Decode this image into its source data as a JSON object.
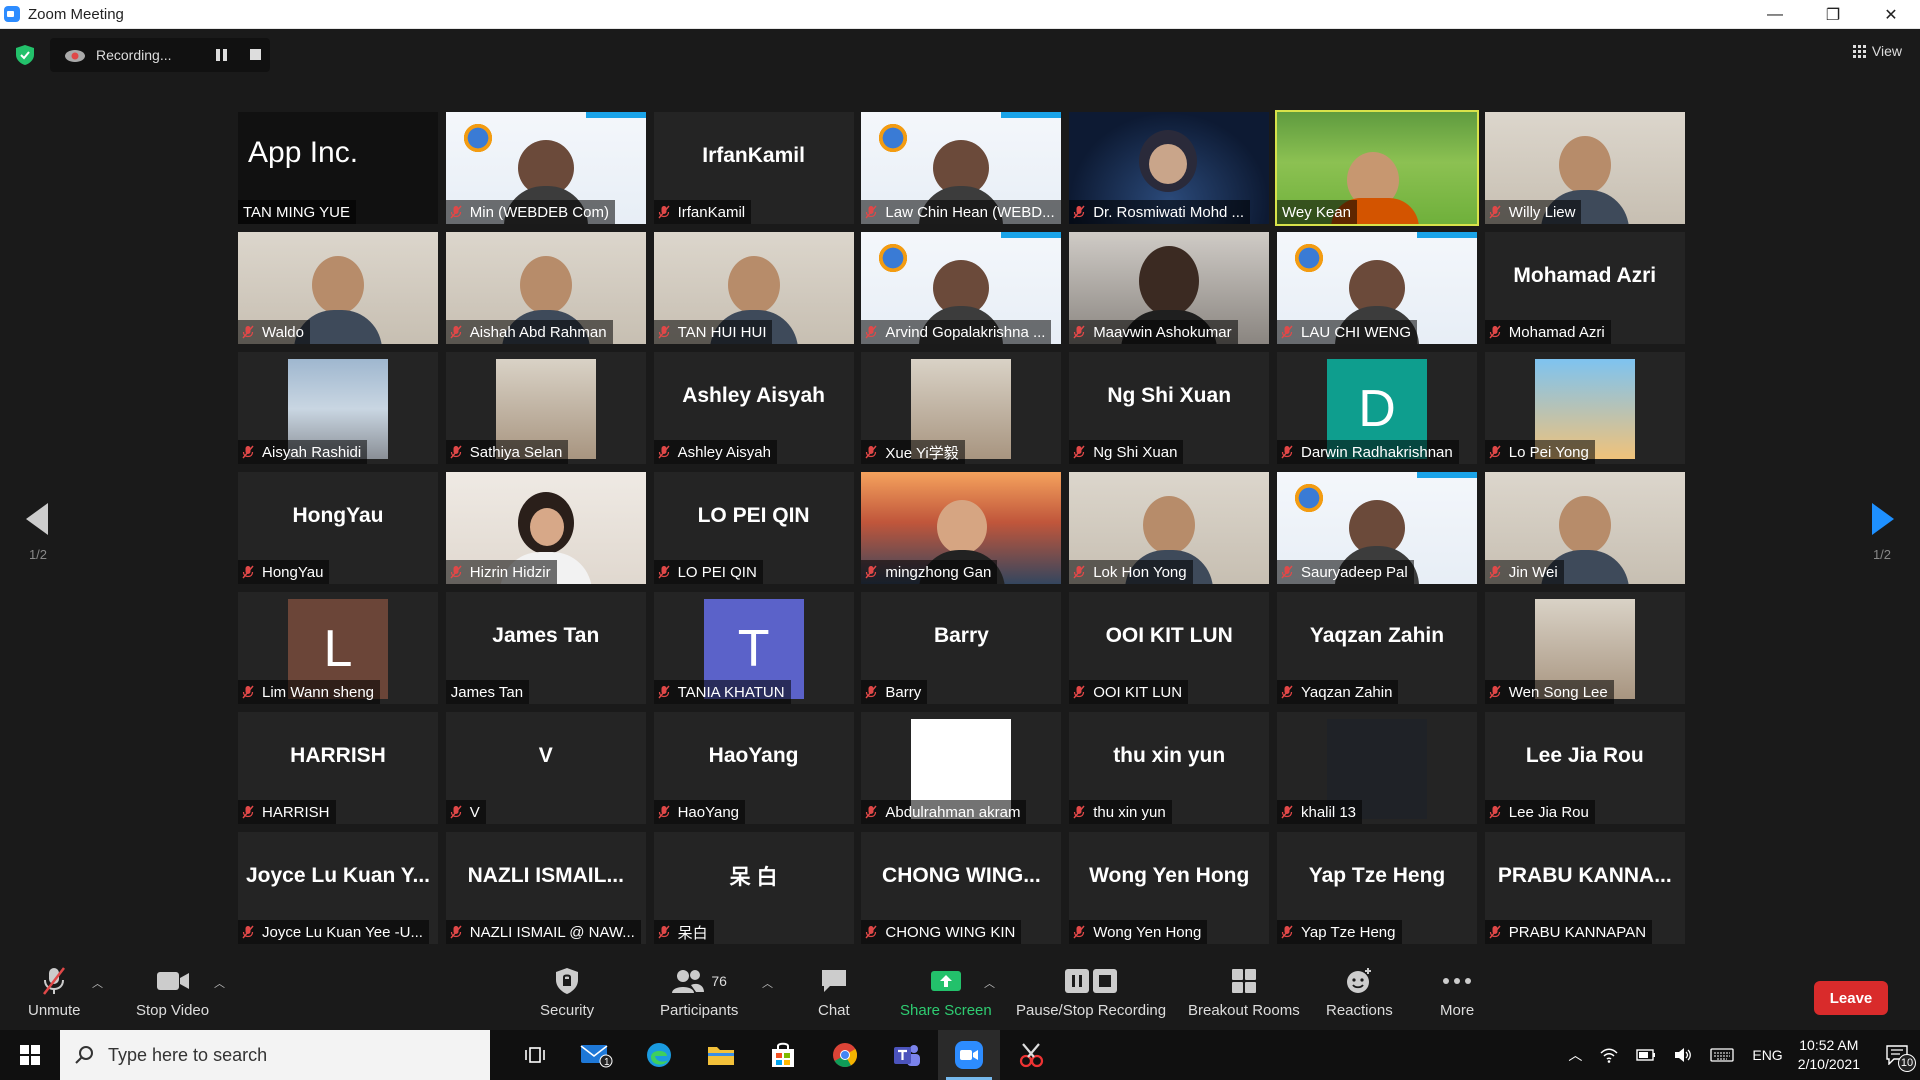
{
  "window": {
    "title": "Zoom Meeting",
    "minimize": "—",
    "restore": "❐",
    "close": "✕"
  },
  "topbar": {
    "recording_label": "Recording...",
    "view_label": "View"
  },
  "paging": {
    "prev_label": "1/2",
    "next_label": "1/2"
  },
  "participants": [
    {
      "name": "TAN MING YUE",
      "kind": "video",
      "muted": false,
      "video_theme": "apple",
      "apple_text": "App  Inc."
    },
    {
      "name": "Min (WEBDEB Com)",
      "kind": "video",
      "muted": true,
      "video_theme": "ieee"
    },
    {
      "name": "IrfanKamil",
      "kind": "text",
      "muted": true,
      "big": "IrfanKamil"
    },
    {
      "name": "Law Chin Hean (WEBD...",
      "kind": "video",
      "muted": true,
      "video_theme": "ieee"
    },
    {
      "name": "Dr. Rosmiwati Mohd ...",
      "kind": "video",
      "muted": true,
      "video_theme": "space"
    },
    {
      "name": "Wey Kean",
      "kind": "video",
      "muted": false,
      "video_theme": "forest",
      "active": true
    },
    {
      "name": "Willy Liew",
      "kind": "video",
      "muted": true,
      "video_theme": "room"
    },
    {
      "name": "Waldo",
      "kind": "video",
      "muted": true,
      "video_theme": "room"
    },
    {
      "name": "Aishah Abd Rahman",
      "kind": "video",
      "muted": true,
      "video_theme": "room"
    },
    {
      "name": "TAN HUI HUI",
      "kind": "video",
      "muted": true,
      "video_theme": "room"
    },
    {
      "name": "Arvind Gopalakrishna ...",
      "kind": "video",
      "muted": true,
      "video_theme": "ieee"
    },
    {
      "name": "Maavwin Ashokumar",
      "kind": "video",
      "muted": true,
      "video_theme": "dark"
    },
    {
      "name": "LAU CHI WENG",
      "kind": "video",
      "muted": true,
      "video_theme": "ieee"
    },
    {
      "name": "Mohamad Azri",
      "kind": "text",
      "muted": true,
      "big": "Mohamad Azri"
    },
    {
      "name": "Aisyah Rashidi",
      "kind": "avatarimg",
      "muted": true,
      "img_theme": "building"
    },
    {
      "name": "Sathiya Selan",
      "kind": "avatarimg",
      "muted": true,
      "img_theme": "person"
    },
    {
      "name": "Ashley Aisyah",
      "kind": "text",
      "muted": true,
      "big": "Ashley Aisyah"
    },
    {
      "name": "Xue Yi学毅",
      "kind": "avatarimg",
      "muted": true,
      "img_theme": "person"
    },
    {
      "name": "Ng Shi Xuan",
      "kind": "text",
      "muted": true,
      "big": "Ng Shi Xuan"
    },
    {
      "name": "Darwin Radhakrishnan",
      "kind": "avatar",
      "muted": true,
      "letter": "D",
      "color": "#0e9e8e"
    },
    {
      "name": "Lo Pei Yong",
      "kind": "avatarimg",
      "muted": true,
      "img_theme": "cartoon"
    },
    {
      "name": "HongYau",
      "kind": "text",
      "muted": true,
      "big": "HongYau"
    },
    {
      "name": "Hizrin Hidzir",
      "kind": "video",
      "muted": true,
      "video_theme": "light"
    },
    {
      "name": "LO PEI QIN",
      "kind": "text",
      "muted": true,
      "big": "LO PEI QIN"
    },
    {
      "name": "mingzhong Gan",
      "kind": "video",
      "muted": true,
      "video_theme": "sunset"
    },
    {
      "name": "Lok Hon Yong",
      "kind": "video",
      "muted": true,
      "video_theme": "room"
    },
    {
      "name": "Sauryadeep Pal",
      "kind": "video",
      "muted": true,
      "video_theme": "ieee"
    },
    {
      "name": "Jin Wei",
      "kind": "video",
      "muted": true,
      "video_theme": "room"
    },
    {
      "name": "Lim Wann sheng",
      "kind": "avatar",
      "muted": true,
      "letter": "L",
      "color": "#6b4538"
    },
    {
      "name": "James Tan",
      "kind": "text",
      "muted": false,
      "big": "James Tan"
    },
    {
      "name": "TANIA KHATUN",
      "kind": "avatar",
      "muted": true,
      "letter": "T",
      "color": "#5b62c9"
    },
    {
      "name": "Barry",
      "kind": "text",
      "muted": true,
      "big": "Barry"
    },
    {
      "name": "OOI KIT LUN",
      "kind": "text",
      "muted": true,
      "big": "OOI KIT LUN"
    },
    {
      "name": "Yaqzan Zahin",
      "kind": "text",
      "muted": true,
      "big": "Yaqzan Zahin"
    },
    {
      "name": "Wen Song Lee",
      "kind": "avatarimg",
      "muted": true,
      "img_theme": "person"
    },
    {
      "name": "HARRISH",
      "kind": "text",
      "muted": true,
      "big": "HARRISH"
    },
    {
      "name": "V",
      "kind": "text",
      "muted": true,
      "big": "V"
    },
    {
      "name": "HaoYang",
      "kind": "text",
      "muted": true,
      "big": "HaoYang"
    },
    {
      "name": "Abdulrahman akram",
      "kind": "avatarimg",
      "muted": true,
      "img_theme": "logo"
    },
    {
      "name": "thu xin yun",
      "kind": "text",
      "muted": true,
      "big": "thu xin yun"
    },
    {
      "name": "khalil 13",
      "kind": "avatarimg",
      "muted": true,
      "img_theme": "blank"
    },
    {
      "name": "Lee Jia Rou",
      "kind": "text",
      "muted": true,
      "big": "Lee Jia Rou"
    },
    {
      "name": "Joyce Lu Kuan Yee -U...",
      "kind": "text",
      "muted": true,
      "big": "Joyce Lu Kuan Y..."
    },
    {
      "name": "NAZLI ISMAIL @ NAW...",
      "kind": "text",
      "muted": true,
      "big": "NAZLI ISMAIL..."
    },
    {
      "name": "呆白",
      "kind": "text",
      "muted": true,
      "big": "呆 白"
    },
    {
      "name": "CHONG WING KIN",
      "kind": "text",
      "muted": true,
      "big": "CHONG WING..."
    },
    {
      "name": "Wong Yen Hong",
      "kind": "text",
      "muted": true,
      "big": "Wong Yen Hong"
    },
    {
      "name": "Yap Tze Heng",
      "kind": "text",
      "muted": true,
      "big": "Yap Tze Heng"
    },
    {
      "name": "PRABU KANNAPAN",
      "kind": "text",
      "muted": true,
      "big": "PRABU KANNA..."
    }
  ],
  "toolbar": {
    "unmute": "Unmute",
    "stop_video": "Stop Video",
    "security": "Security",
    "participants": "Participants",
    "participants_count": "76",
    "chat": "Chat",
    "share_screen": "Share Screen",
    "pause_stop_recording": "Pause/Stop Recording",
    "breakout_rooms": "Breakout Rooms",
    "reactions": "Reactions",
    "more": "More",
    "leave": "Leave"
  },
  "taskbar": {
    "search_placeholder": "Type here to search",
    "mail_badge": "1",
    "language": "ENG",
    "time": "10:52 AM",
    "date": "2/10/2021",
    "notification_count": "10"
  },
  "colors": {
    "accent_green": "#2ecc71",
    "leave_red": "#d92b2b",
    "active_speaker": "#d8e24a",
    "mic_off_red": "#e04848"
  }
}
